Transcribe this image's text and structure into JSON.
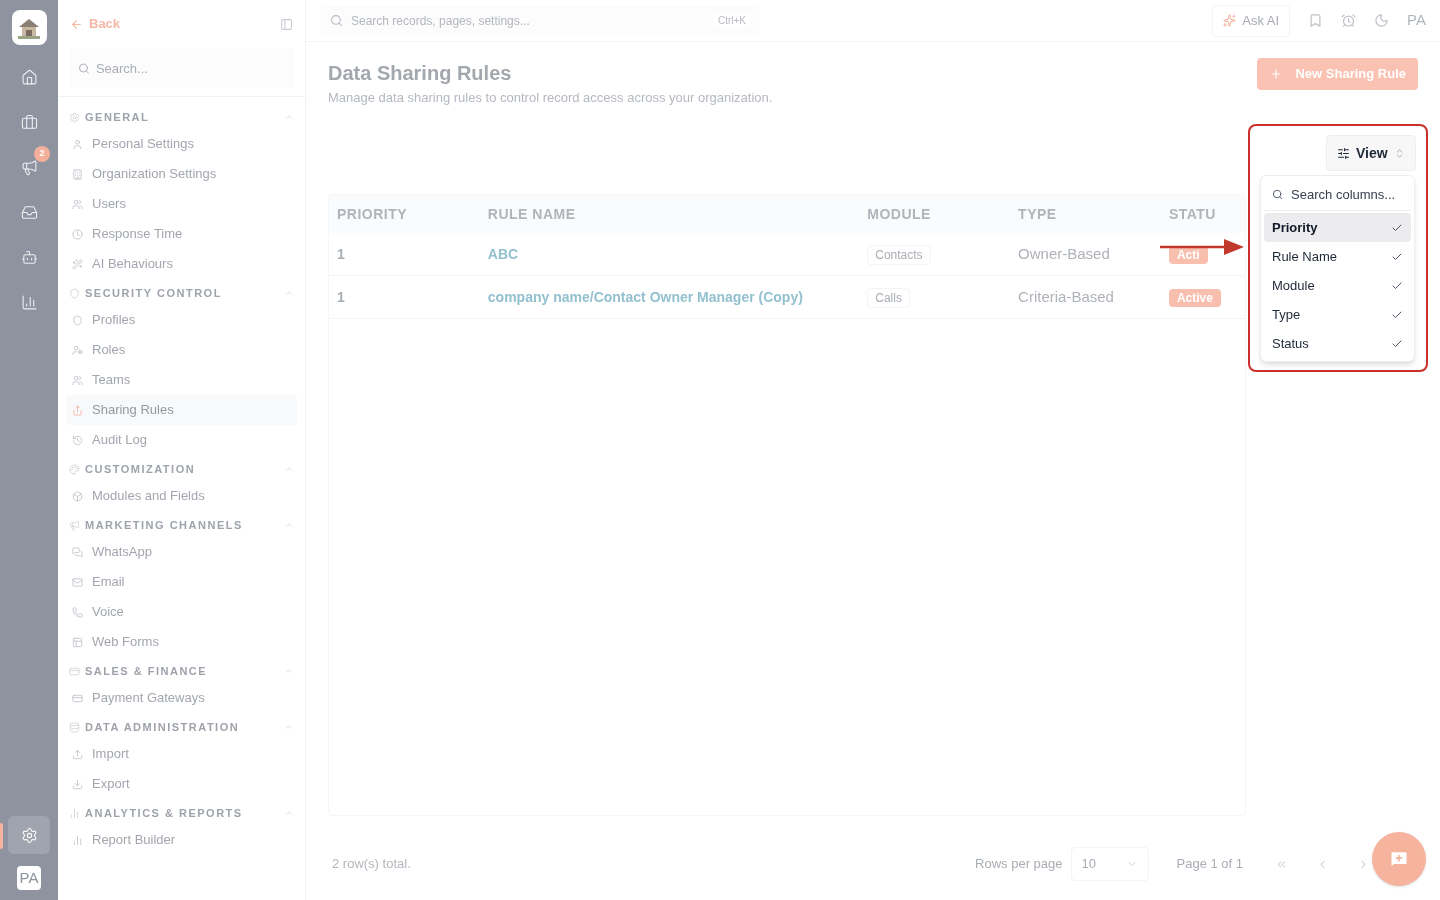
{
  "rail": {
    "items": [
      {
        "selected": false
      },
      {
        "selected": false
      },
      {
        "selected": false,
        "badge": "2"
      },
      {
        "selected": false
      },
      {
        "selected": false
      },
      {
        "selected": false
      }
    ],
    "settings": {
      "selected": true
    },
    "avatar": "PA"
  },
  "sidebar": {
    "back": "Back",
    "search": {
      "placeholder": "Search..."
    },
    "sections": [
      {
        "title": "GENERAL",
        "expanded": true,
        "items": [
          {
            "label": "Personal Settings",
            "selected": false
          },
          {
            "label": "Organization Settings",
            "selected": false
          },
          {
            "label": "Users",
            "selected": false
          },
          {
            "label": "Response Time",
            "selected": false
          },
          {
            "label": "AI Behaviours",
            "selected": false
          }
        ]
      },
      {
        "title": "SECURITY CONTROL",
        "expanded": true,
        "items": [
          {
            "label": "Profiles",
            "selected": false
          },
          {
            "label": "Roles",
            "selected": false
          },
          {
            "label": "Teams",
            "selected": false
          },
          {
            "label": "Sharing Rules",
            "selected": true
          },
          {
            "label": "Audit Log",
            "selected": false
          }
        ]
      },
      {
        "title": "CUSTOMIZATION",
        "expanded": true,
        "items": [
          {
            "label": "Modules and Fields",
            "selected": false
          }
        ]
      },
      {
        "title": "MARKETING CHANNELS",
        "expanded": true,
        "items": [
          {
            "label": "WhatsApp",
            "selected": false
          },
          {
            "label": "Email",
            "selected": false
          },
          {
            "label": "Voice",
            "selected": false
          },
          {
            "label": "Web Forms",
            "selected": false
          }
        ]
      },
      {
        "title": "SALES & FINANCE",
        "expanded": true,
        "items": [
          {
            "label": "Payment Gateways",
            "selected": false
          }
        ]
      },
      {
        "title": "DATA ADMINISTRATION",
        "expanded": true,
        "items": [
          {
            "label": "Import",
            "selected": false
          },
          {
            "label": "Export",
            "selected": false
          }
        ]
      },
      {
        "title": "ANALYTICS & REPORTS",
        "expanded": true,
        "items": [
          {
            "label": "Report Builder",
            "selected": false
          }
        ]
      }
    ]
  },
  "topbar": {
    "search": {
      "placeholder": "Search records, pages, settings..."
    },
    "shortcut": "Ctrl+K",
    "ask_ai": "Ask AI",
    "avatar": "PA"
  },
  "page": {
    "title": "Data Sharing Rules",
    "subtitle": "Manage data sharing rules to control record access across your organization.",
    "new_button": "New Sharing Rule"
  },
  "view_button": "View",
  "column_menu": {
    "search": {
      "placeholder": "Search columns..."
    },
    "items": [
      {
        "label": "Priority",
        "checked": true,
        "selected": true
      },
      {
        "label": "Rule Name",
        "checked": true,
        "selected": false
      },
      {
        "label": "Module",
        "checked": true,
        "selected": false
      },
      {
        "label": "Type",
        "checked": true,
        "selected": false
      },
      {
        "label": "Status",
        "checked": true,
        "selected": false
      }
    ]
  },
  "table": {
    "columns": [
      "PRIORITY",
      "RULE NAME",
      "MODULE",
      "TYPE",
      "STATU"
    ],
    "rows": [
      {
        "priority": "1",
        "rule_name": "ABC",
        "module": "Contacts",
        "type": "Owner-Based",
        "status": "Acti"
      },
      {
        "priority": "1",
        "rule_name": "company name/Contact Owner Manager (Copy)",
        "module": "Calls",
        "type": "Criteria-Based",
        "status": "Active"
      }
    ]
  },
  "footer": {
    "total": "2 row(s) total.",
    "rows_per_page": "Rows per page",
    "page_size": "10",
    "page_info": "Page 1 of 1"
  }
}
